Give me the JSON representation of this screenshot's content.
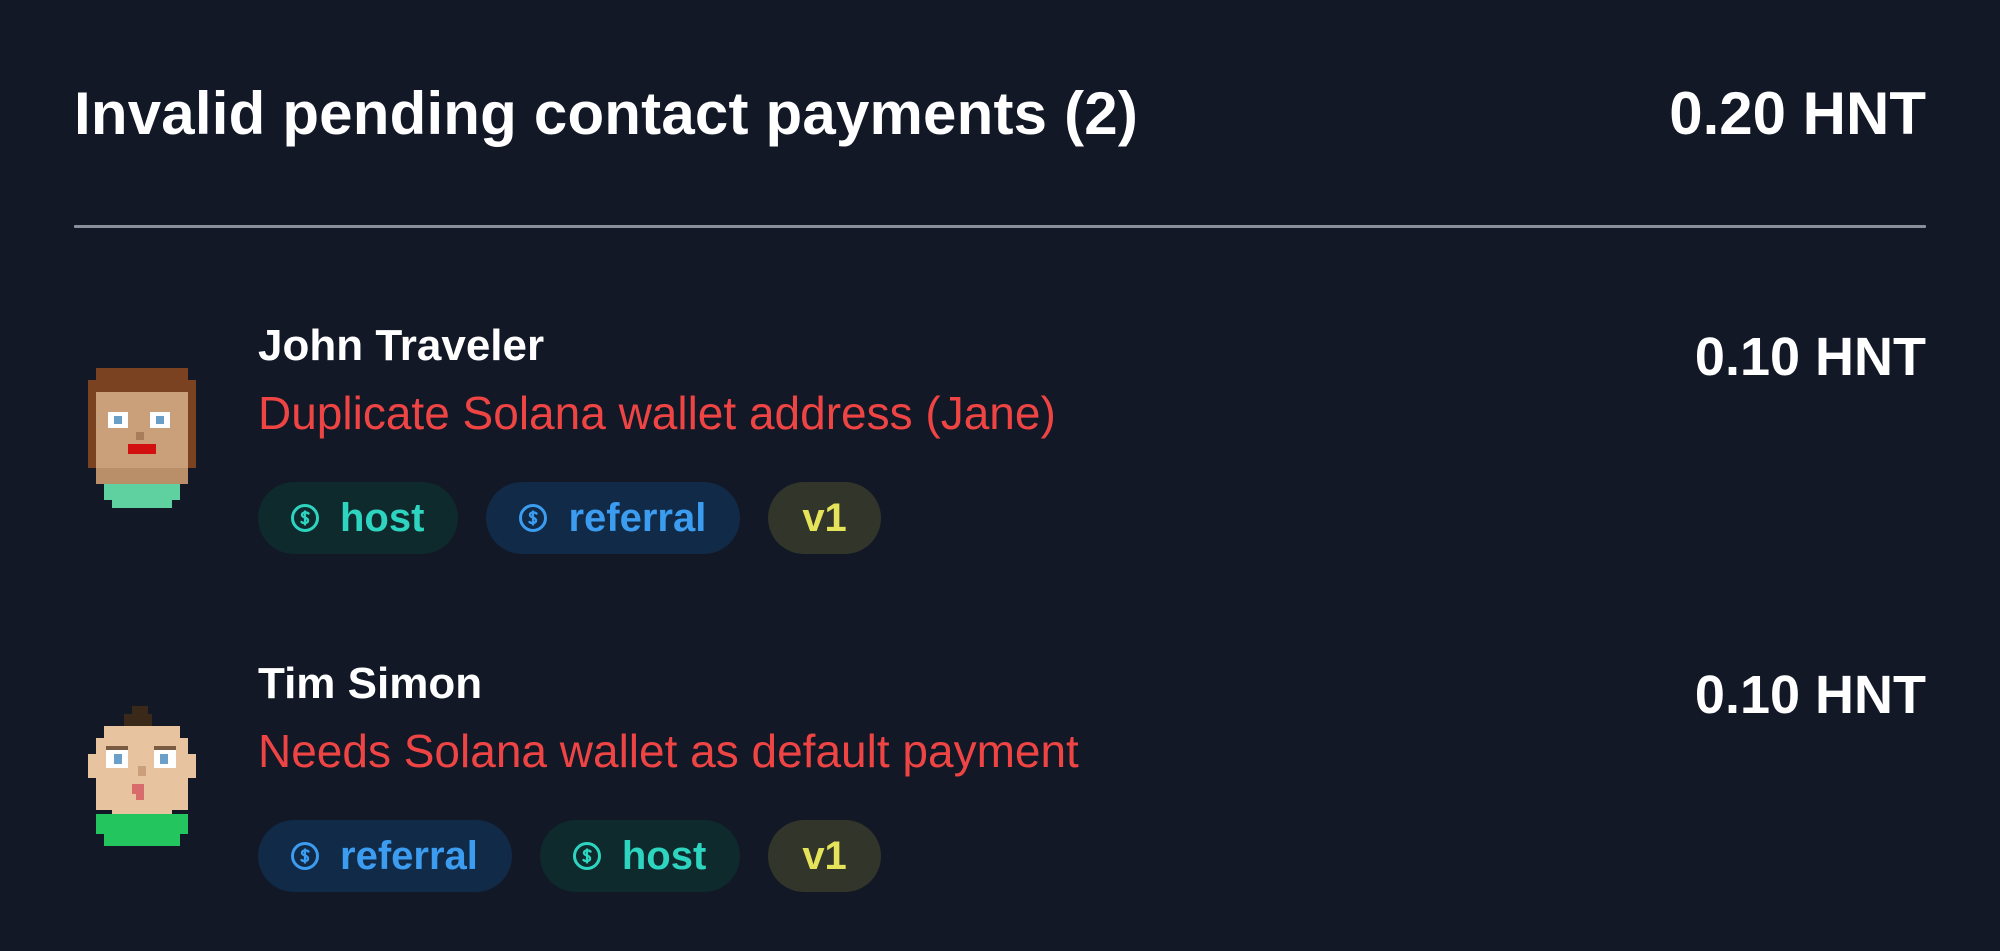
{
  "header": {
    "title": "Invalid pending contact payments (2)",
    "total": "0.20 HNT"
  },
  "payments": [
    {
      "name": "John Traveler",
      "reason": "Duplicate Solana wallet address (Jane)",
      "amount": "0.10 HNT",
      "tags": [
        {
          "label": "host",
          "icon": "dollar-circle-icon"
        },
        {
          "label": "referral",
          "icon": "dollar-circle-icon"
        },
        {
          "label": "v1"
        }
      ]
    },
    {
      "name": "Tim Simon",
      "reason": "Needs Solana wallet as default payment",
      "amount": "0.10 HNT",
      "tags": [
        {
          "label": "referral",
          "icon": "dollar-circle-icon"
        },
        {
          "label": "host",
          "icon": "dollar-circle-icon"
        },
        {
          "label": "v1"
        }
      ]
    }
  ],
  "colors": {
    "background": "#121826",
    "error": "#ef4444",
    "host": "#2dd4bf",
    "referral": "#3b9cf0",
    "version": "#e4e35a"
  }
}
